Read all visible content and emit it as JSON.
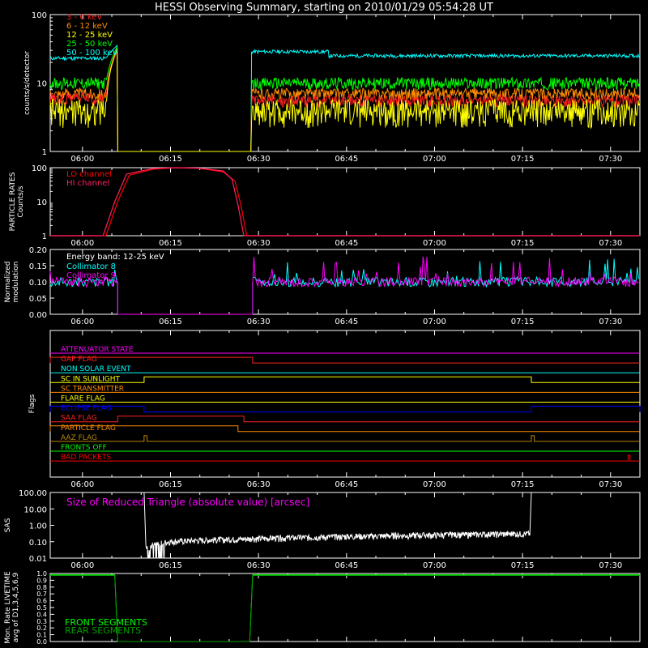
{
  "title": "HESSI Observing Summary, starting on 2010/01/29 05:54:28 UT",
  "time_ticks": [
    "06:00",
    "06:15",
    "06:30",
    "06:45",
    "07:00",
    "07:15",
    "07:30"
  ],
  "time_tick_minutes": [
    360,
    375,
    390,
    405,
    420,
    435,
    450
  ],
  "colors": {
    "foreground": "#ffffff",
    "e3_6": "#ff2020",
    "e6_12": "#ff8c00",
    "e12_25": "#ffff00",
    "e25_50": "#00ff00",
    "e50_100": "#00ffff",
    "particle_lo": "#ff0000",
    "particle_hi": "#ff2060",
    "magenta": "#ff00ff",
    "green": "#00ff00",
    "blue": "#0000ff"
  },
  "chart_data": [
    {
      "id": "count-rates",
      "type": "line",
      "ylabel": "counts/s/detector",
      "yscale": "log",
      "ylim": [
        1,
        100
      ],
      "ytick_labels": [
        "1",
        "10",
        "100"
      ],
      "x_unit": "minutes of day",
      "xlim": [
        354.5,
        455
      ],
      "series": [
        {
          "name": "3 - 6 keV",
          "color": "#ff2020",
          "points": [
            [
              354.5,
              6
            ],
            [
              364,
              6
            ],
            [
              366,
              30
            ],
            [
              366.5,
              1
            ],
            [
              388.5,
              1
            ],
            [
              389,
              5.5
            ],
            [
              455,
              5.5
            ]
          ]
        },
        {
          "name": "6 - 12 keV",
          "color": "#ff8c00",
          "points": [
            [
              354.5,
              7
            ],
            [
              364,
              7
            ],
            [
              366,
              32
            ],
            [
              366.5,
              1
            ],
            [
              388.5,
              1
            ],
            [
              389,
              7.5
            ],
            [
              455,
              7
            ]
          ]
        },
        {
          "name": "12 - 25 keV",
          "color": "#ffff00",
          "points": [
            [
              354.5,
              4
            ],
            [
              364,
              4
            ],
            [
              366,
              33
            ],
            [
              366.5,
              1
            ],
            [
              388.5,
              1
            ],
            [
              389,
              5
            ],
            [
              455,
              4
            ]
          ]
        },
        {
          "name": "25 - 50 keV",
          "color": "#00ff00",
          "points": [
            [
              354.5,
              10
            ],
            [
              364,
              10
            ],
            [
              366,
              35
            ],
            [
              366.5,
              1
            ],
            [
              388.5,
              1
            ],
            [
              389,
              12
            ],
            [
              455,
              10
            ]
          ]
        },
        {
          "name": "50 - 100 keV",
          "color": "#00ffff",
          "points": [
            [
              354.5,
              23
            ],
            [
              365,
              23
            ],
            [
              366,
              36
            ],
            [
              366.3,
              1
            ],
            [
              388.5,
              1
            ],
            [
              388.8,
              30
            ],
            [
              402,
              27
            ],
            [
              455,
              25
            ]
          ]
        }
      ]
    },
    {
      "id": "particle-rates",
      "type": "line",
      "ylabel": "PARTICLE RATES\nCounts/s",
      "yscale": "log",
      "ylim": [
        1,
        100
      ],
      "ytick_labels": [
        "1",
        "10",
        "100"
      ],
      "series": [
        {
          "name": "LO channel",
          "color": "#ff0000",
          "points": [
            [
              354.5,
              1
            ],
            [
              364,
              1
            ],
            [
              366,
              10
            ],
            [
              368,
              60
            ],
            [
              372,
              90
            ],
            [
              376,
              100
            ],
            [
              380,
              95
            ],
            [
              384,
              75
            ],
            [
              386,
              40
            ],
            [
              387,
              8
            ],
            [
              388,
              1
            ],
            [
              455,
              1
            ]
          ]
        },
        {
          "name": "HI channel",
          "color": "#ff2060",
          "points": [
            [
              354.5,
              1
            ],
            [
              363.5,
              1
            ],
            [
              365.5,
              10
            ],
            [
              367.5,
              65
            ],
            [
              372,
              95
            ],
            [
              376,
              100
            ],
            [
              380,
              97
            ],
            [
              384,
              80
            ],
            [
              385.5,
              45
            ],
            [
              386.5,
              8
            ],
            [
              387.5,
              1
            ],
            [
              455,
              1
            ]
          ]
        }
      ]
    },
    {
      "id": "modulation",
      "type": "line",
      "ylabel": "Normalized\nmodulation",
      "ylim": [
        0,
        0.2
      ],
      "ytick_labels": [
        "0.00",
        "0.05",
        "0.10",
        "0.15",
        "0.20"
      ],
      "energy_band": "Energy band: 12-25 keV",
      "series": [
        {
          "name": "Collimator 8",
          "color": "#00ffff",
          "base": 0.1,
          "segments": [
            [
              354.5,
              366
            ],
            [
              389,
              455
            ]
          ]
        },
        {
          "name": "Collimator 9",
          "color": "#ff00ff",
          "base": 0.1,
          "segments": [
            [
              354.5,
              366
            ],
            [
              389,
              455
            ]
          ]
        }
      ]
    },
    {
      "id": "flags",
      "type": "line",
      "ylabel": "Flags",
      "flags": [
        {
          "name": "ATTENUATOR STATE",
          "color": "#ff00ff",
          "high": []
        },
        {
          "name": "GAP FLAG",
          "color": "#ff2020",
          "high": [
            [
              354.5,
              389
            ]
          ]
        },
        {
          "name": "NON SOLAR EVENT",
          "color": "#00ffff",
          "high": []
        },
        {
          "name": "SC IN SUNLIGHT",
          "color": "#ffff00",
          "high": [
            [
              370.5,
              436.5
            ]
          ]
        },
        {
          "name": "SC TRANSMITTER",
          "color": "#ff8c00",
          "high": []
        },
        {
          "name": "FLARE FLAG",
          "color": "#ffff00",
          "high": []
        },
        {
          "name": "ECLIPSE FLAG",
          "color": "#0000ff",
          "high": [
            [
              354.5,
              370.5
            ],
            [
              436.5,
              455
            ]
          ]
        },
        {
          "name": "SAA FLAG",
          "color": "#ff2020",
          "high": [
            [
              366,
              387.5
            ]
          ]
        },
        {
          "name": "PARTICLE FLAG",
          "color": "#ff8c00",
          "high": [
            [
              354.5,
              386.5
            ]
          ]
        },
        {
          "name": "AAZ FLAG",
          "color": "#b8860b",
          "high": [
            [
              370.5,
              371
            ],
            [
              436.5,
              437
            ]
          ]
        },
        {
          "name": "FRONTS OFF",
          "color": "#00ff00",
          "high": []
        },
        {
          "name": "BAD PACKETS",
          "color": "#ff0000",
          "high": [
            [
              453,
              453.3
            ]
          ]
        }
      ]
    },
    {
      "id": "sas",
      "type": "line",
      "ylabel": "SAS",
      "yscale": "log",
      "ylim": [
        0.01,
        100
      ],
      "ytick_labels": [
        "0.01",
        "0.10",
        "1.00",
        "10.00",
        "100.00"
      ],
      "annotation": "Size of Reduced Triangle (absolute value) [arcsec]",
      "series": [
        {
          "name": "triangle",
          "color": "#ffffff",
          "points": [
            [
              370.5,
              100
            ],
            [
              371,
              0.03
            ],
            [
              375,
              0.1
            ],
            [
              390,
              0.15
            ],
            [
              410,
              0.2
            ],
            [
              430,
              0.25
            ],
            [
              436,
              0.3
            ],
            [
              436.5,
              100
            ]
          ]
        }
      ]
    },
    {
      "id": "livetime",
      "type": "line",
      "ylabel": "Mon. Rate LIVETIME\navg of D1,3,4,5,6,9",
      "ylim": [
        0,
        1
      ],
      "ytick_labels": [
        "0.0",
        "0.1",
        "0.2",
        "0.3",
        "0.4",
        "0.5",
        "0.6",
        "0.7",
        "0.8",
        "0.9",
        "1.0"
      ],
      "series": [
        {
          "name": "FRONT SEGMENTS",
          "color": "#00ff00",
          "points": [
            [
              354.5,
              0.98
            ],
            [
              365.5,
              0.98
            ],
            [
              366,
              0
            ],
            [
              388.5,
              0
            ],
            [
              389,
              0.98
            ],
            [
              455,
              0.98
            ]
          ]
        },
        {
          "name": "REAR SEGMENTS",
          "color": "#00a000",
          "points": [
            [
              354.5,
              0.97
            ],
            [
              365.5,
              0.97
            ],
            [
              366,
              0
            ],
            [
              388.5,
              0
            ],
            [
              389,
              0.97
            ],
            [
              455,
              0.97
            ]
          ]
        }
      ]
    }
  ]
}
